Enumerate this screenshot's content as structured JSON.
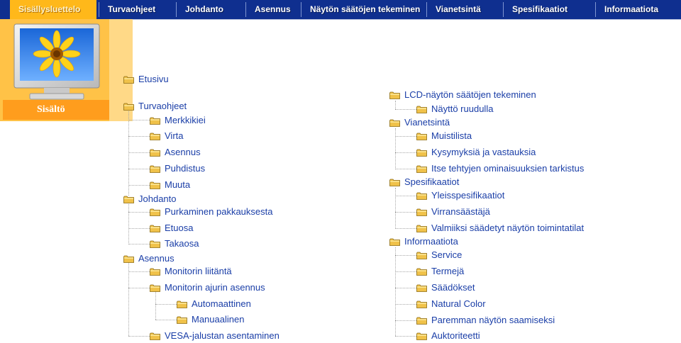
{
  "nav": [
    {
      "label": "Sisällysluettelo",
      "active": true
    },
    {
      "label": "Turvaohjeet"
    },
    {
      "label": "Johdanto"
    },
    {
      "label": "Asennus"
    },
    {
      "label": "Näytön säätöjen tekeminen"
    },
    {
      "label": "Vianetsintä"
    },
    {
      "label": "Spesifikaatiot"
    },
    {
      "label": "Informaatiota"
    }
  ],
  "header": {
    "label": "Sisältö",
    "image_icon": "monitor-sunflower-icon"
  },
  "colors": {
    "nav_bg": "#0f2f8f",
    "active_tab": "#ffb81a",
    "header_panel": "#ffc247",
    "link": "#1a3ea7",
    "folder": "#f0c24a"
  },
  "tree": {
    "left": [
      {
        "label": "Etusivu",
        "level": 0
      },
      {
        "label": "Turvaohjeet",
        "level": 0
      },
      {
        "label": "Merkkikiei",
        "level": 1
      },
      {
        "label": "Virta",
        "level": 1
      },
      {
        "label": "Asennus",
        "level": 1
      },
      {
        "label": "Puhdistus",
        "level": 1
      },
      {
        "label": "Muuta",
        "level": 1
      },
      {
        "label": "Johdanto",
        "level": 0
      },
      {
        "label": "Purkaminen pakkauksesta",
        "level": 1
      },
      {
        "label": "Etuosa",
        "level": 1
      },
      {
        "label": "Takaosa",
        "level": 1
      },
      {
        "label": "Asennus",
        "level": 0
      },
      {
        "label": "Monitorin liitäntä",
        "level": 1
      },
      {
        "label": "Monitorin ajurin asennus",
        "level": 1
      },
      {
        "label": "Automaattinen",
        "level": 2
      },
      {
        "label": "Manuaalinen",
        "level": 2
      },
      {
        "label": "VESA-jalustan asentaminen",
        "level": 1
      }
    ],
    "right": [
      {
        "label": "LCD-näytön säätöjen tekeminen",
        "level": 0
      },
      {
        "label": "Näyttö ruudulla",
        "level": 1
      },
      {
        "label": "Vianetsintä",
        "level": 0
      },
      {
        "label": "Muistilista",
        "level": 1
      },
      {
        "label": "Kysymyksiä ja vastauksia",
        "level": 1
      },
      {
        "label": "Itse tehtyjen ominaisuuksien tarkistus",
        "level": 1
      },
      {
        "label": "Spesifikaatiot",
        "level": 0
      },
      {
        "label": "Yleisspesifikaatiot",
        "level": 1
      },
      {
        "label": "Virransäästäjä",
        "level": 1
      },
      {
        "label": "Valmiiksi säädetyt näytön toimintatilat",
        "level": 1
      },
      {
        "label": "Informaatiota",
        "level": 0
      },
      {
        "label": "Service",
        "level": 1
      },
      {
        "label": "Termejä",
        "level": 1
      },
      {
        "label": "Säädökset",
        "level": 1
      },
      {
        "label": "Natural Color",
        "level": 1
      },
      {
        "label": "Paremman näytön saamiseksi",
        "level": 1
      },
      {
        "label": "Auktoriteetti",
        "level": 1
      }
    ]
  }
}
